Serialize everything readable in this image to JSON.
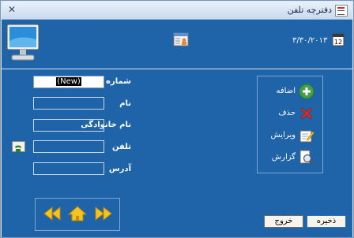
{
  "window": {
    "title": "دفترچه تلفن"
  },
  "header": {
    "date": "۳/۳۰/۲۰۱۳"
  },
  "form": {
    "fields": [
      {
        "label": "شماره",
        "value": "(New)"
      },
      {
        "label": "نام",
        "value": ""
      },
      {
        "label": "نام خانوادگی",
        "value": ""
      },
      {
        "label": "تلفن",
        "value": ""
      },
      {
        "label": "آدرس",
        "value": ""
      }
    ]
  },
  "actions": [
    {
      "label": "اضافه",
      "icon": "add-icon"
    },
    {
      "label": "حذف",
      "icon": "delete-icon"
    },
    {
      "label": "ویرایش",
      "icon": "edit-icon"
    },
    {
      "label": "گزارش",
      "icon": "report-icon"
    }
  ],
  "buttons": {
    "save": "ذخیره",
    "exit": "خروج"
  },
  "colors": {
    "panel": "#1f64a8",
    "accent_green": "#43a047",
    "delete_red": "#d32f2f",
    "nav_yellow": "#f6c324"
  }
}
